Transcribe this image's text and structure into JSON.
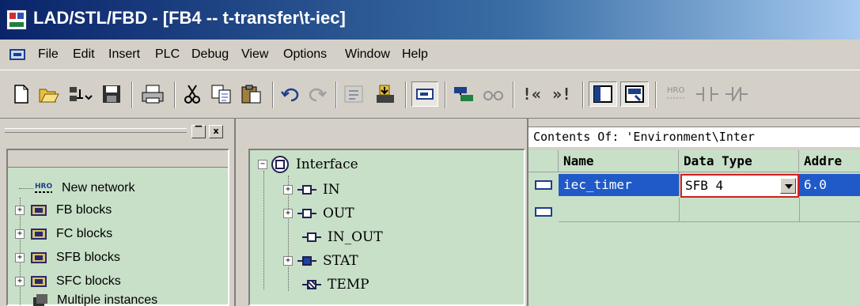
{
  "window": {
    "title": "LAD/STL/FBD  - [FB4 -- t-transfer\\t-iec]"
  },
  "menu": [
    "File",
    "Edit",
    "Insert",
    "PLC",
    "Debug",
    "View",
    "Options",
    "Window",
    "Help"
  ],
  "toolbar": {
    "nav_left": "!«",
    "nav_right": "»!",
    "icons": [
      "new-icon",
      "open-icon",
      "network-icon",
      "save-icon",
      "print-icon",
      "cut-icon",
      "copy-icon",
      "paste-icon",
      "undo-icon",
      "redo-icon",
      "compile-icon",
      "download-icon",
      "interface-icon",
      "online-icon",
      "glasses-icon",
      "overview-icon",
      "detail-icon",
      "new-network-icon",
      "contact-icon"
    ]
  },
  "left_panel": {
    "close_label": "x",
    "items": [
      {
        "label": "New network",
        "icon": "new-network-icon"
      },
      {
        "label": "FB blocks",
        "icon": "block-icon"
      },
      {
        "label": "FC blocks",
        "icon": "block-icon"
      },
      {
        "label": "SFB blocks",
        "icon": "block-icon"
      },
      {
        "label": "SFC blocks",
        "icon": "block-icon"
      },
      {
        "label": "Multiple instances",
        "icon": "multi-instance-icon"
      }
    ]
  },
  "interface_tree": {
    "root": "Interface",
    "items": [
      "IN",
      "OUT",
      "IN_OUT",
      "STAT",
      "TEMP"
    ]
  },
  "contents": {
    "label": "Contents Of: 'Environment\\Inter",
    "columns": [
      "Name",
      "Data Type",
      "Addre"
    ],
    "rows": [
      {
        "name": "iec_timer",
        "data_type": "SFB 4",
        "address": "6.0"
      }
    ]
  },
  "colors": {
    "title_gradient_start": "#0a246a",
    "title_gradient_end": "#a6caf0",
    "pane_background": "#c8e0c8",
    "selection": "#1f5ac8",
    "editor_border": "#d02020"
  }
}
